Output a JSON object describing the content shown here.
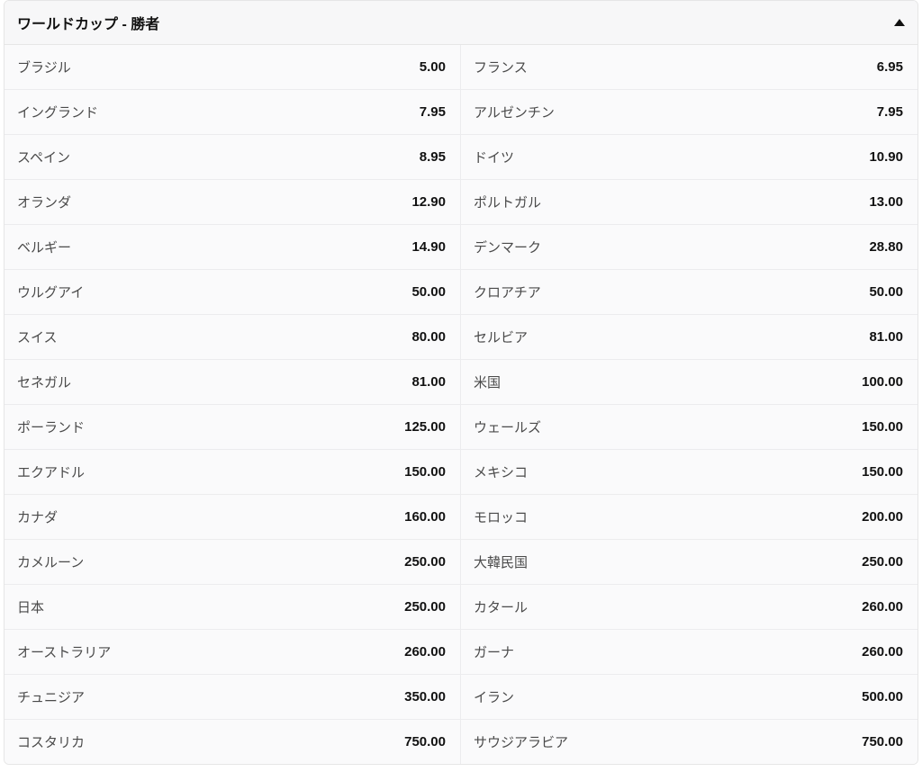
{
  "header": {
    "title": "ワールドカップ - 勝者"
  },
  "rows": [
    {
      "name": "ブラジル",
      "odds": "5.00"
    },
    {
      "name": "フランス",
      "odds": "6.95"
    },
    {
      "name": "イングランド",
      "odds": "7.95"
    },
    {
      "name": "アルゼンチン",
      "odds": "7.95"
    },
    {
      "name": "スペイン",
      "odds": "8.95"
    },
    {
      "name": "ドイツ",
      "odds": "10.90"
    },
    {
      "name": "オランダ",
      "odds": "12.90"
    },
    {
      "name": "ポルトガル",
      "odds": "13.00"
    },
    {
      "name": "ベルギー",
      "odds": "14.90"
    },
    {
      "name": "デンマーク",
      "odds": "28.80"
    },
    {
      "name": "ウルグアイ",
      "odds": "50.00"
    },
    {
      "name": "クロアチア",
      "odds": "50.00"
    },
    {
      "name": "スイス",
      "odds": "80.00"
    },
    {
      "name": "セルビア",
      "odds": "81.00"
    },
    {
      "name": "セネガル",
      "odds": "81.00"
    },
    {
      "name": "米国",
      "odds": "100.00"
    },
    {
      "name": "ポーランド",
      "odds": "125.00"
    },
    {
      "name": "ウェールズ",
      "odds": "150.00"
    },
    {
      "name": "エクアドル",
      "odds": "150.00"
    },
    {
      "name": "メキシコ",
      "odds": "150.00"
    },
    {
      "name": "カナダ",
      "odds": "160.00"
    },
    {
      "name": "モロッコ",
      "odds": "200.00"
    },
    {
      "name": "カメルーン",
      "odds": "250.00"
    },
    {
      "name": "大韓民国",
      "odds": "250.00"
    },
    {
      "name": "日本",
      "odds": "250.00"
    },
    {
      "name": "カタール",
      "odds": "260.00"
    },
    {
      "name": "オーストラリア",
      "odds": "260.00"
    },
    {
      "name": "ガーナ",
      "odds": "260.00"
    },
    {
      "name": "チュニジア",
      "odds": "350.00"
    },
    {
      "name": "イラン",
      "odds": "500.00"
    },
    {
      "name": "コスタリカ",
      "odds": "750.00"
    },
    {
      "name": "サウジアラビア",
      "odds": "750.00"
    }
  ]
}
